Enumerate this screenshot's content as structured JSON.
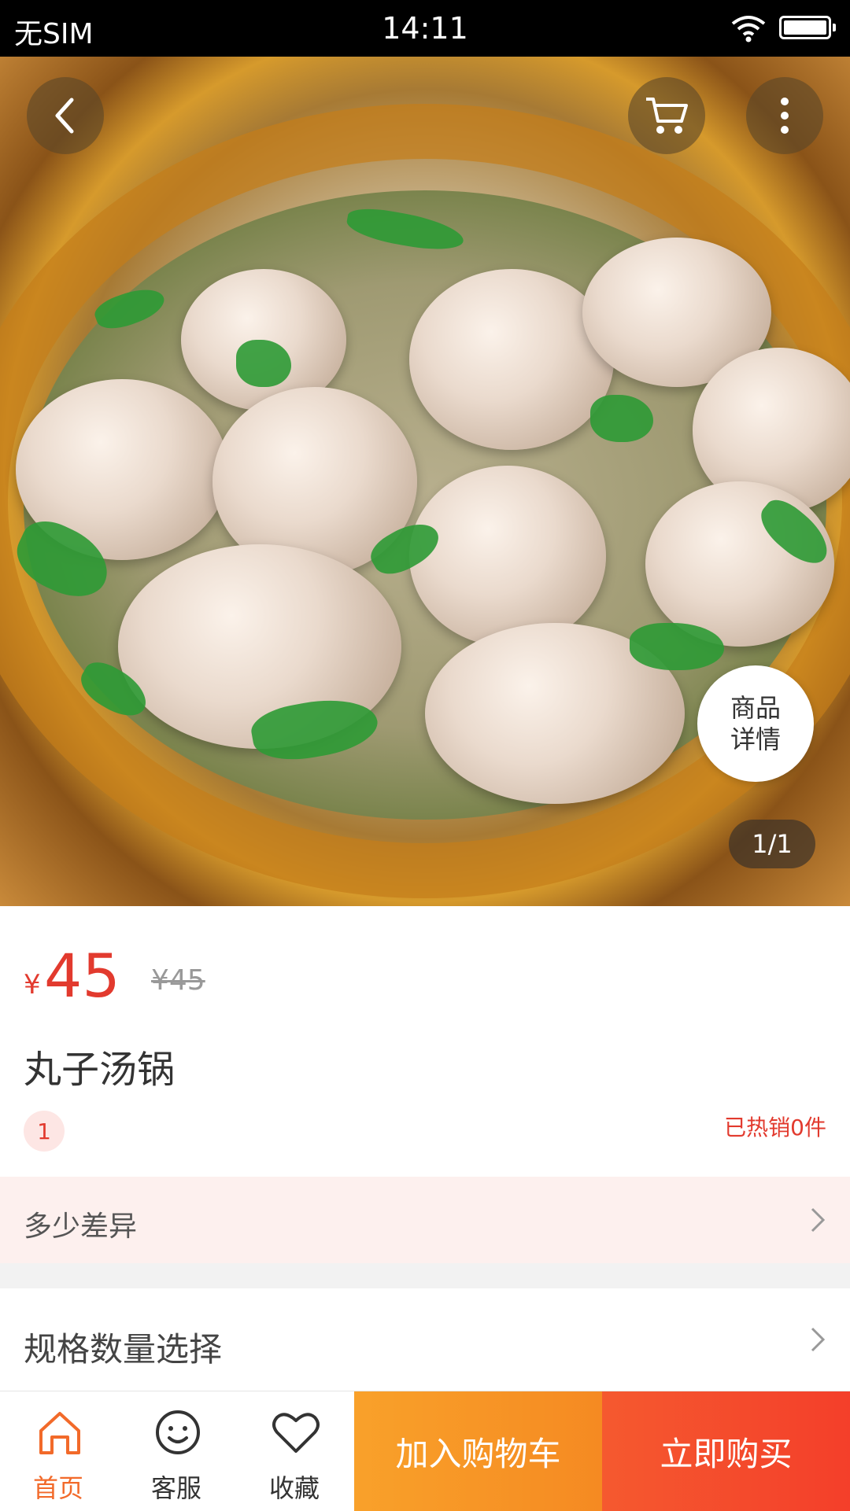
{
  "status_bar": {
    "carrier": "无SIM",
    "time": "14:11"
  },
  "hero": {
    "detail_line1": "商品",
    "detail_line2": "详情",
    "page_indicator": "1/1"
  },
  "product": {
    "currency_symbol": "¥",
    "price": "45",
    "original_price": "¥45",
    "name": "丸子汤锅",
    "tag_number": "1",
    "sold_count": "已热销0件"
  },
  "rows": {
    "promo_label": "多少差异",
    "spec_label": "规格数量选择"
  },
  "bottom_nav": {
    "home": "首页",
    "service": "客服",
    "favorite": "收藏",
    "add_to_cart": "加入购物车",
    "buy_now": "立即购买"
  },
  "colors": {
    "accent": "#e23a2e",
    "nav_active": "#f26a2a",
    "cart_button": "#f9a12a",
    "buy_button": "#f43f2a"
  }
}
